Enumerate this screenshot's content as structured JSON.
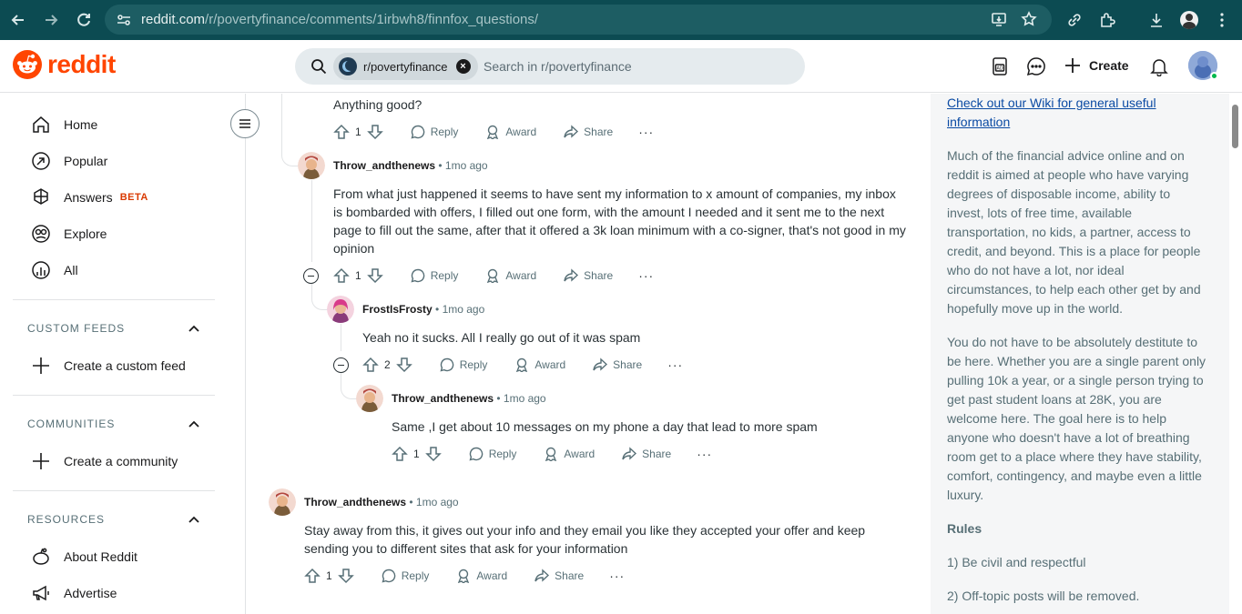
{
  "browser": {
    "url_host": "reddit.com",
    "url_path": "/r/povertyfinance/comments/1irbwh8/finnfox_questions/"
  },
  "header": {
    "logo_text": "reddit",
    "search_chip": "r/povertyfinance",
    "search_placeholder": "Search in r/povertyfinance",
    "create_label": "Create"
  },
  "sidebar": {
    "nav": [
      {
        "label": "Home",
        "icon": "home-icon"
      },
      {
        "label": "Popular",
        "icon": "popular-icon"
      },
      {
        "label": "Answers",
        "badge": "BETA",
        "icon": "answers-icon"
      },
      {
        "label": "Explore",
        "icon": "explore-icon"
      },
      {
        "label": "All",
        "icon": "all-icon"
      }
    ],
    "custom_feeds": {
      "title": "CUSTOM FEEDS",
      "item": "Create a custom feed"
    },
    "communities": {
      "title": "COMMUNITIES",
      "item": "Create a community"
    },
    "resources": {
      "title": "RESOURCES",
      "items": [
        "About Reddit",
        "Advertise"
      ]
    }
  },
  "comments": [
    {
      "text": "Anything good?",
      "votes": "1"
    },
    {
      "author": "Throw_andthenews",
      "time": "1mo ago",
      "text": "From what just happened it seems to have sent my information to x amount of companies, my inbox is bombarded with offers, I filled out one form, with the amount I needed and it sent me to the next page to fill out the same, after that it offered a 3k loan minimum with a co-signer, that's not good in my opinion",
      "votes": "1"
    },
    {
      "author": "FrostIsFrosty",
      "time": "1mo ago",
      "text": "Yeah no it sucks. All I really go out of it was spam",
      "votes": "2"
    },
    {
      "author": "Throw_andthenews",
      "time": "1mo ago",
      "text": "Same ,I get about 10 messages on my phone a day that lead to more spam",
      "votes": "1"
    },
    {
      "author": "Throw_andthenews",
      "time": "1mo ago",
      "text": "Stay away from this, it gives out your info and they email you like they accepted your offer and keep sending you to different sites that ask for your information",
      "votes": "1"
    }
  ],
  "actions": {
    "reply": "Reply",
    "award": "Award",
    "share": "Share",
    "more": "···",
    "separator": "•"
  },
  "rightpanel": {
    "wiki_link": "Check out our Wiki for general useful information",
    "p1": "Much of the financial advice online and on reddit is aimed at people who have varying degrees of disposable income, ability to invest, lots of free time, available transportation, no kids, a partner, access to credit, and beyond. This is a place for people who do not have a lot, nor ideal circumstances, to help each other get by and hopefully move up in the world.",
    "p2": "You do not have to be absolutely destitute to be here. Whether you are a single parent only pulling 10k a year, or a single person trying to get past student loans at 28K, you are welcome here. The goal here is to help anyone who doesn't have a lot of breathing room get to a place where they have stability, comfort, contingency, and maybe even a little luxury.",
    "rules_title": "Rules",
    "rules": [
      "1) Be civil and respectful",
      "2) Off-topic posts will be removed."
    ]
  },
  "colors": {
    "brand": "#ff4500",
    "browser_bar": "#0c4b52",
    "link": "#0a4aa3"
  }
}
